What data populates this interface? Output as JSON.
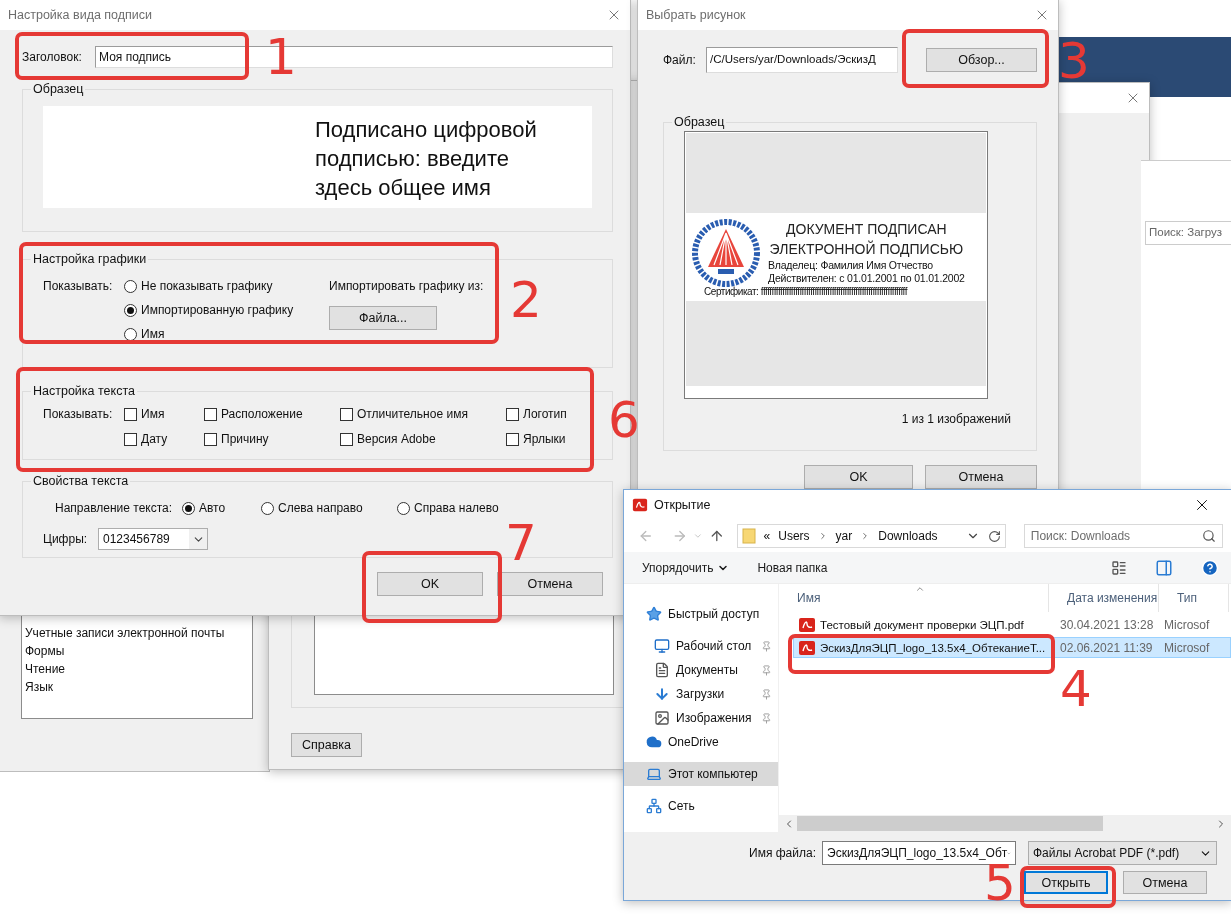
{
  "background_list": {
    "items": [
      "Учетные записи электронной почты",
      "Формы",
      "Чтение",
      "Язык"
    ]
  },
  "background_dialog": {
    "help_button": "Справка"
  },
  "background_search": {
    "placeholder": "Поиск: Загруз"
  },
  "signature_dialog": {
    "title": "Настройка вида подписи",
    "title_label": "Заголовок:",
    "title_value": "Моя подпись",
    "sample": {
      "legend": "Образец",
      "text": "Подписано цифровой подписью: введите здесь общее имя"
    },
    "graphics": {
      "legend": "Настройка графики",
      "show_label": "Показывать:",
      "options": [
        {
          "label": "Не показывать графику",
          "selected": false
        },
        {
          "label": "Импортированную графику",
          "selected": true
        },
        {
          "label": "Имя",
          "selected": false
        }
      ],
      "import_label": "Импортировать графику из:",
      "file_button": "Файла..."
    },
    "text_settings": {
      "legend": "Настройка текста",
      "show_label": "Показывать:",
      "checkboxes": [
        {
          "label": "Имя",
          "checked": false
        },
        {
          "label": "Расположение",
          "checked": false
        },
        {
          "label": "Отличительное имя",
          "checked": false
        },
        {
          "label": "Логотип",
          "checked": false
        },
        {
          "label": "Дату",
          "checked": false
        },
        {
          "label": "Причину",
          "checked": false
        },
        {
          "label": "Версия Adobe",
          "checked": false
        },
        {
          "label": "Ярлыки",
          "checked": false
        }
      ]
    },
    "text_properties": {
      "legend": "Свойства текста",
      "direction_label": "Направление текста:",
      "directions": [
        {
          "label": "Авто",
          "selected": true
        },
        {
          "label": "Слева направо",
          "selected": false
        },
        {
          "label": "Справа налево",
          "selected": false
        }
      ],
      "digits_label": "Цифры:",
      "digits_value": "0123456789"
    },
    "ok_button": "OK",
    "cancel_button": "Отмена"
  },
  "picture_dialog": {
    "title": "Выбрать рисунок",
    "file_label": "Файл:",
    "file_value": "/C/Users/yar/Downloads/ЭскизД",
    "browse_button": "Обзор...",
    "sample_legend": "Образец",
    "preview": {
      "heading": [
        "ДОКУМЕНТ ПОДПИСАН",
        "ЭЛЕКТРОННОЙ ПОДПИСЬЮ"
      ],
      "owner": "Владелец: Фамилия Имя Отчество",
      "validity": "Действителен: с 01.01.2001 по 01.01.2002",
      "certificate": "Сертификат: ffffffffffffffffffffffffffffffffffffffffffffffffffffffffffffffffffff"
    },
    "counter": "1 из 1 изображений",
    "ok_button": "OK",
    "cancel_button": "Отмена"
  },
  "open_dialog": {
    "title": "Открытие",
    "path_prefix": "«",
    "path": [
      "Users",
      "yar",
      "Downloads"
    ],
    "search_placeholder": "Поиск: Downloads",
    "organize": "Упорядочить",
    "new_folder": "Новая папка",
    "sidebar": [
      {
        "label": "Быстрый доступ",
        "kind": "star",
        "pinned": false,
        "selected": false
      },
      {
        "label": "Рабочий стол",
        "kind": "desktop",
        "pinned": true,
        "selected": false
      },
      {
        "label": "Документы",
        "kind": "documents",
        "pinned": true,
        "selected": false
      },
      {
        "label": "Загрузки",
        "kind": "downloads",
        "pinned": true,
        "selected": false
      },
      {
        "label": "Изображения",
        "kind": "pictures",
        "pinned": true,
        "selected": false
      },
      {
        "label": "OneDrive",
        "kind": "cloud",
        "pinned": false,
        "selected": false
      },
      {
        "label": "Этот компьютер",
        "kind": "computer",
        "pinned": false,
        "selected": true
      },
      {
        "label": "Сеть",
        "kind": "network",
        "pinned": false,
        "selected": false
      }
    ],
    "columns": [
      "Имя",
      "Дата изменения",
      "Тип"
    ],
    "files": [
      {
        "name": "Тестовый документ проверки ЭЦП.pdf",
        "date": "30.04.2021 13:28",
        "type": "Microsof",
        "selected": false
      },
      {
        "name": "ЭскизДляЭЦП_logo_13.5x4_ОбтеканиеТ...",
        "date": "02.06.2021 11:39",
        "type": "Microsof",
        "selected": true
      }
    ],
    "filename_label": "Имя файла:",
    "filename_value": "ЭскизДляЭЦП_logo_13.5x4_Обт",
    "filter": "Файлы Acrobat PDF (*.pdf)",
    "open_button": "Открыть",
    "cancel_button": "Отмена"
  },
  "annotations": [
    {
      "number": "1"
    },
    {
      "number": "2"
    },
    {
      "number": "3"
    },
    {
      "number": "4"
    },
    {
      "number": "5"
    },
    {
      "number": "6"
    },
    {
      "number": "7"
    }
  ]
}
